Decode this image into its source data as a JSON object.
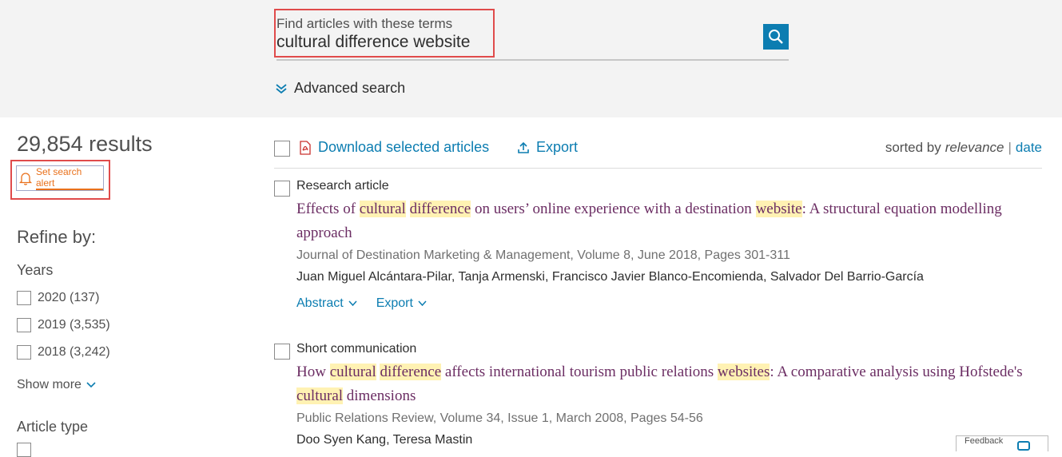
{
  "search": {
    "label": "Find articles with these terms",
    "value": "cultural difference website",
    "advanced": "Advanced search"
  },
  "sidebar": {
    "results_count": "29,854 results",
    "set_alert": "Set search alert",
    "refine_by": "Refine by:",
    "years_heading": "Years",
    "years": [
      {
        "label": "2020 (137)"
      },
      {
        "label": "2019 (3,535)"
      },
      {
        "label": "2018 (3,242)"
      }
    ],
    "show_more": "Show more",
    "article_type_heading": "Article type"
  },
  "toolbar": {
    "download": "Download selected articles",
    "export": "Export",
    "sorted_by": "sorted by",
    "relevance": "relevance",
    "separator": "|",
    "date": "date"
  },
  "results": [
    {
      "type": "Research article",
      "title_parts": [
        {
          "t": "Effects of ",
          "h": false
        },
        {
          "t": "cultural",
          "h": true
        },
        {
          "t": " ",
          "h": false
        },
        {
          "t": "difference",
          "h": true
        },
        {
          "t": " on users’ online experience with a destination ",
          "h": false
        },
        {
          "t": "website",
          "h": true
        },
        {
          "t": ": A structural equation modelling approach",
          "h": false
        }
      ],
      "source": "Journal of Destination Marketing & Management, Volume 8, June 2018, Pages 301-311",
      "authors": "Juan Miguel Alcántara-Pilar, Tanja Armenski, Francisco Javier Blanco-Encomienda, Salvador Del Barrio-García",
      "abstract_label": "Abstract",
      "export_label": "Export"
    },
    {
      "type": "Short communication",
      "title_parts": [
        {
          "t": "How ",
          "h": false
        },
        {
          "t": "cultural",
          "h": true
        },
        {
          "t": " ",
          "h": false
        },
        {
          "t": "difference",
          "h": true
        },
        {
          "t": " affects international tourism public relations ",
          "h": false
        },
        {
          "t": "websites",
          "h": true
        },
        {
          "t": ": A comparative analysis using Hofstede's ",
          "h": false
        },
        {
          "t": "cultural",
          "h": true
        },
        {
          "t": " dimensions",
          "h": false
        }
      ],
      "source": "Public Relations Review, Volume 34, Issue 1, March 2008, Pages 54-56",
      "authors": "Doo Syen Kang, Teresa Mastin"
    }
  ],
  "feedback": "Feedback",
  "colors": {
    "accent": "#0c7db1",
    "title": "#6b2d63",
    "highlight": "#fff2b3",
    "alert": "#e9711c",
    "annotation": "#e04b4b"
  }
}
